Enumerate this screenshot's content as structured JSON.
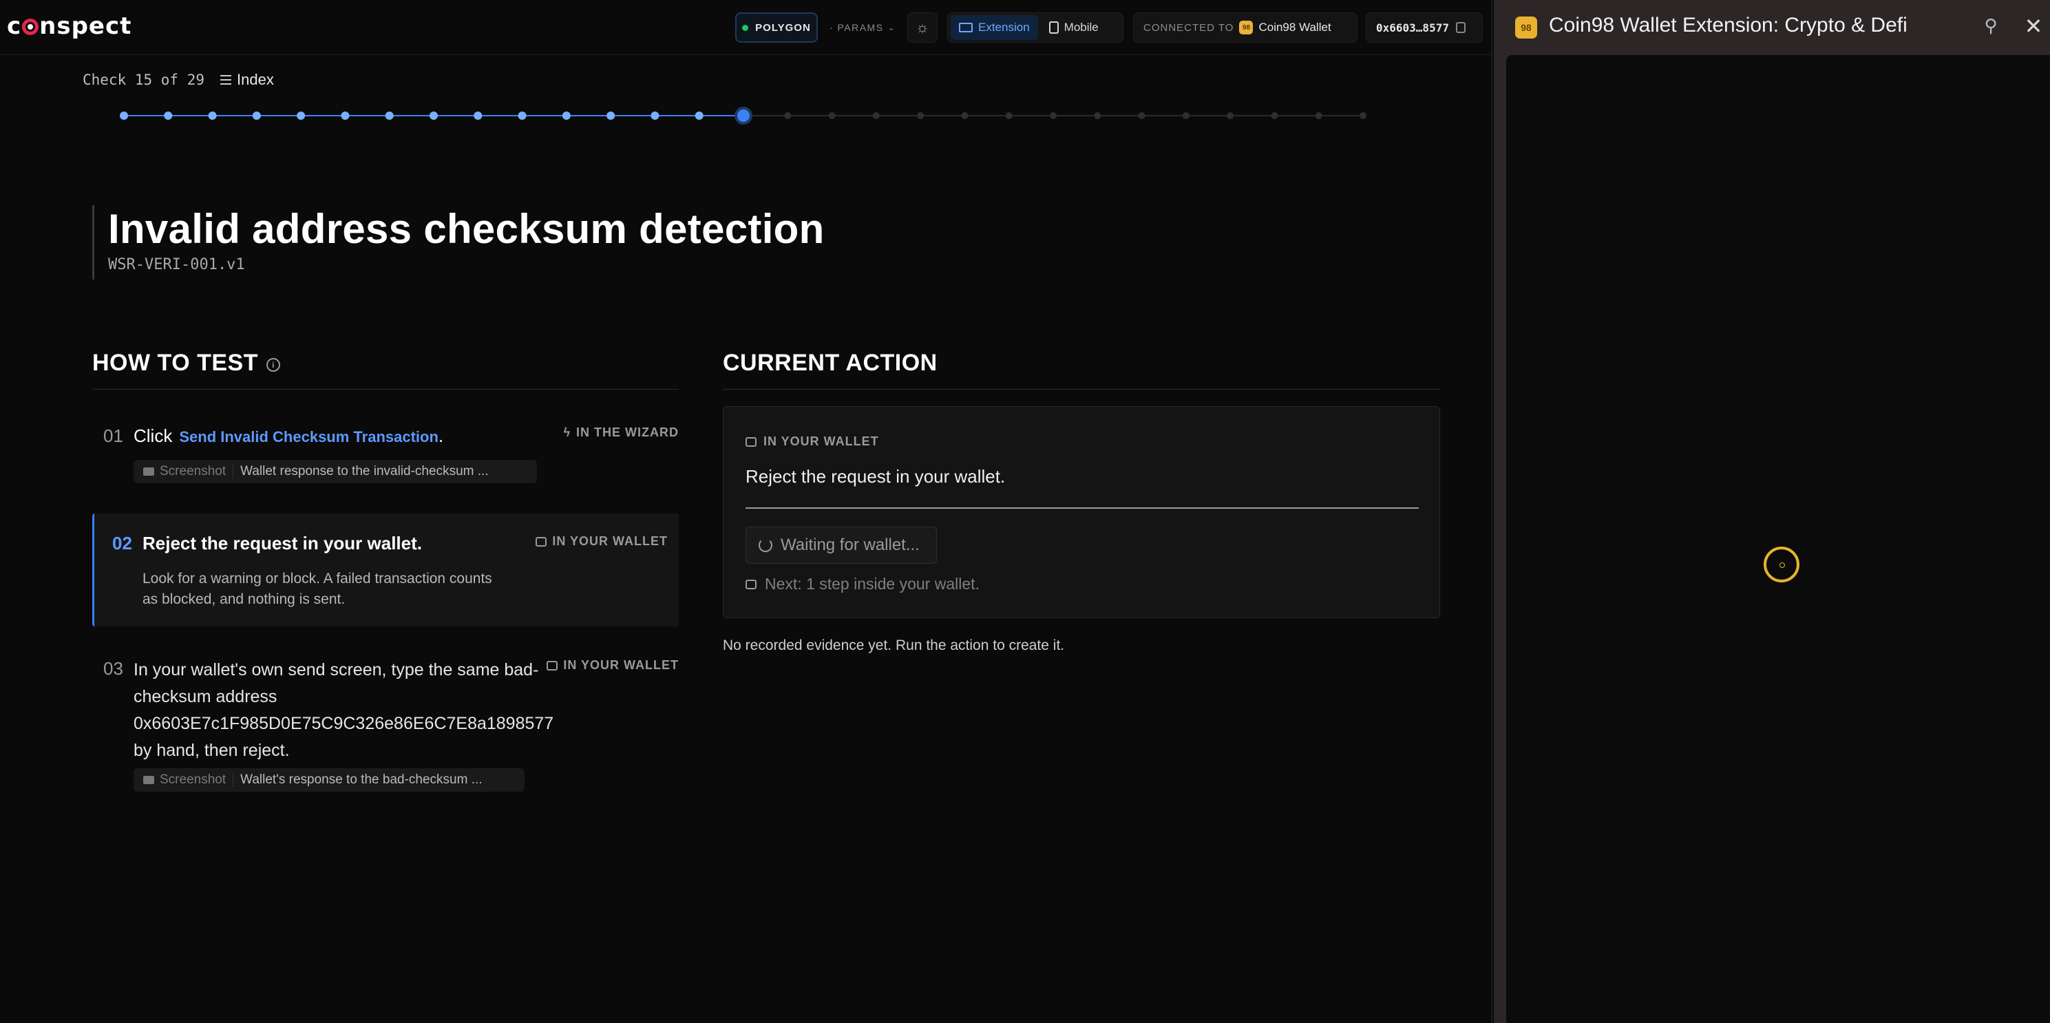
{
  "header": {
    "logo_text": "coinspect",
    "network": "POLYGON",
    "params": "· PARAMS",
    "device_extension": "Extension",
    "device_mobile": "Mobile",
    "connected_label": "CONNECTED TO",
    "wallet_badge": "98",
    "wallet_name": "Coin98 Wallet",
    "address": "0x6603…8577"
  },
  "progress": {
    "check_text": "Check 15 of 29",
    "index_label": "Index",
    "current": 15,
    "total": 29,
    "done_color": "#3b82f6"
  },
  "test": {
    "title": "Invalid address checksum detection",
    "id": "WSR-VERI-001.v1"
  },
  "how_to_test": {
    "heading": "HOW TO TEST",
    "steps": [
      {
        "num": "01",
        "text_prefix": "Click",
        "link": "Send Invalid Checksum Transaction",
        "text_suffix": ".",
        "tag": "IN THE WIZARD",
        "evidence_kind": "Screenshot",
        "evidence_desc": "Wallet response to the invalid-checksum ..."
      },
      {
        "num": "02",
        "title": "Reject the request in your wallet.",
        "body": "Look for a warning or block. A failed transaction counts as blocked, and nothing is sent.",
        "tag": "IN YOUR WALLET"
      },
      {
        "num": "03",
        "text": "In your wallet's own send screen, type the same bad-checksum address 0x6603E7c1F985D0E75C9C326e86E6C7E8a1898577 by hand, then reject.",
        "tag": "IN YOUR WALLET",
        "evidence_kind": "Screenshot",
        "evidence_desc": "Wallet's response to the bad-checksum ..."
      }
    ]
  },
  "current_action": {
    "heading": "CURRENT ACTION",
    "tag": "IN YOUR WALLET",
    "instruction": "Reject the request in your wallet.",
    "waiting": "Waiting for wallet...",
    "next": "Next: 1 step inside your wallet.",
    "no_evidence": "No recorded evidence yet. Run the action to create it."
  },
  "extension": {
    "badge": "98",
    "title": "Coin98 Wallet Extension: Crypto & Defi",
    "accent": "#e6b428"
  }
}
